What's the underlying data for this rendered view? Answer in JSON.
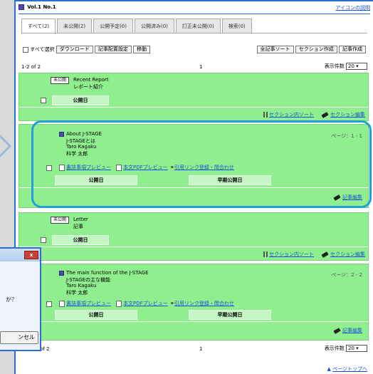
{
  "header": {
    "volume": "Vol.1 No.1",
    "icon_help": "アイコンの説明"
  },
  "tabs": [
    {
      "label": "すべて(2)",
      "active": true
    },
    {
      "label": "未公開(2)"
    },
    {
      "label": "公開予定(0)"
    },
    {
      "label": "公開済み(0)"
    },
    {
      "label": "訂正未公開(0)"
    },
    {
      "label": "検索(0)"
    }
  ],
  "toolbar": {
    "select_all": "すべて選択",
    "download": "ダウンロード",
    "article_settings": "記事配置設定",
    "move": "移動",
    "sort_all": "全記事ソート",
    "create_section": "セクション作成",
    "create_article": "記事作成"
  },
  "pager": {
    "count": "1-2 of 2",
    "count_bottom": "of 2",
    "page": "1",
    "per_page_label": "表示件数",
    "per_page_value": "20"
  },
  "sections": [
    {
      "badge": "未公開",
      "title_en": "Recent Report",
      "title_ja": "レポート紹介",
      "pub": "公開日",
      "sort": "セクション内ソート",
      "edit": "セクション編集"
    },
    {
      "badge": "未公開",
      "title_en": "Letter",
      "title_ja": "記事",
      "pub": "公開日",
      "sort": "セクション内ソート",
      "edit": "セクション編集"
    }
  ],
  "articles": [
    {
      "title_en": "About J-STAGE",
      "title_ja": "J-STAGEとは",
      "author_en": "Taro Kagaku",
      "author_ja": "科学 太郎",
      "pages": "ページ：1 - 1",
      "preview": "書誌事項プレビュー",
      "pdf": "本文PDFプレビュー",
      "cite": "引用リンク登録・問合わせ",
      "pub": "公開日",
      "early": "早期公開日",
      "edit": "記事編集"
    },
    {
      "title_en": "The main function of the J-STAGE",
      "title_ja": "J-STAGEの主な機能",
      "author_en": "Taro Kagaku",
      "author_ja": "科学 太郎",
      "pages": "ページ：2 - 2",
      "preview": "書誌事項プレビュー",
      "pdf": "本文PDFプレビュー",
      "cite": "引用リンク登録・問合わせ",
      "pub": "公開日",
      "early": "早期公開日",
      "edit": "記事編集"
    }
  ],
  "dialog": {
    "close": "x",
    "question": "か？",
    "cancel": "ンセル"
  },
  "footer": {
    "page_top": "ページトップへ"
  },
  "colors": {
    "accent": "#2a6fd1",
    "block_green": "#8fef8f",
    "highlight_ring": "#1ea2d6"
  }
}
